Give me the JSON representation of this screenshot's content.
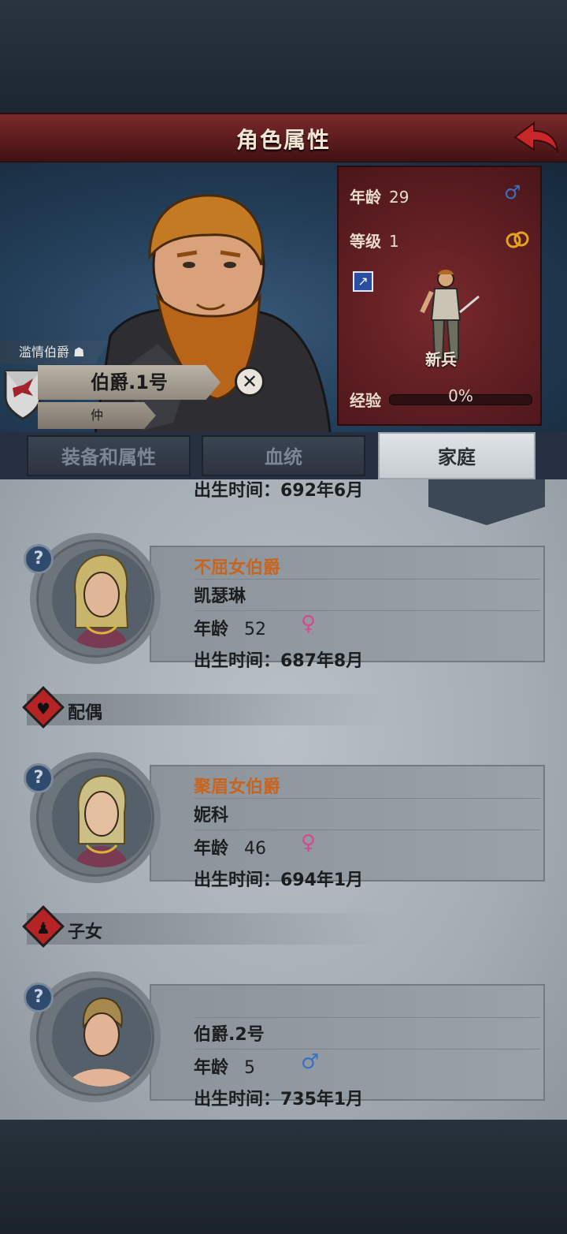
{
  "header": {
    "title": "角色属性"
  },
  "character": {
    "epithet": "滥情伯爵",
    "name": "伯爵.1号",
    "rank_tag": "仲",
    "stats": {
      "age_label": "年龄",
      "age": "29",
      "level_label": "等级",
      "level": "1",
      "class_name": "新兵",
      "exp_label": "经验",
      "exp_value": "0%",
      "exp_fraction": 0
    }
  },
  "tabs": [
    "装备和属性",
    "血统",
    "家庭"
  ],
  "partial_member": {
    "birth": "出生时间：692年6月"
  },
  "members": [
    {
      "title": "不屈女伯爵",
      "name": "凯瑟琳",
      "age_label": "年龄",
      "age": "52",
      "birth": "出生时间：687年8月",
      "gender": "♀",
      "gender_color": "#d14b8f"
    },
    {
      "title": "聚眉女伯爵",
      "name": "妮科",
      "age_label": "年龄",
      "age": "46",
      "birth": "出生时间：694年1月",
      "gender": "♀",
      "gender_color": "#d14b8f"
    },
    {
      "title": "",
      "name": "伯爵.2号",
      "age_label": "年龄",
      "age": "5",
      "birth": "出生时间：735年1月",
      "gender": "♂",
      "gender_color": "#3a6fc4"
    }
  ],
  "sections": {
    "spouse": "配偶",
    "children": "子女"
  },
  "colors": {
    "male": "#3a6fc4",
    "female": "#d14b8f",
    "title_orange": "#c9641e",
    "header_red": "#5c1c1e"
  }
}
